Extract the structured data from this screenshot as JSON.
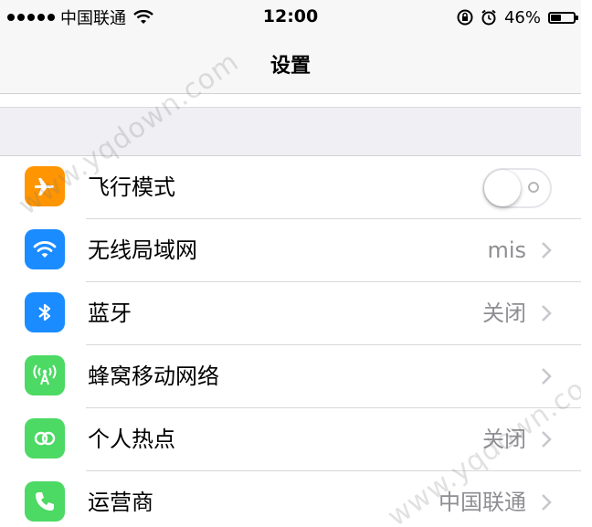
{
  "status_bar": {
    "carrier": "中国联通",
    "time": "12:00",
    "battery": "46%",
    "battery_level": 0.46,
    "icons": [
      "signal-dots-icon",
      "wifi-icon",
      "rotation-lock-icon",
      "alarm-icon",
      "battery-icon"
    ]
  },
  "nav": {
    "title": "设置"
  },
  "settings": [
    {
      "label": "飞行模式",
      "icon": "airplane-icon",
      "color": "#ff9500",
      "toggle": "off"
    },
    {
      "label": "无线局域网",
      "icon": "wifi-icon",
      "color": "#1a8cff",
      "value": "mis"
    },
    {
      "label": "蓝牙",
      "icon": "bluetooth-icon",
      "color": "#1a8cff",
      "value": "关闭"
    },
    {
      "label": "蜂窝移动网络",
      "icon": "cellular-icon",
      "color": "#4cd964",
      "value": ""
    },
    {
      "label": "个人热点",
      "icon": "hotspot-icon",
      "color": "#4cd964",
      "value": "关闭"
    },
    {
      "label": "运营商",
      "icon": "phone-icon",
      "color": "#4cd964",
      "value": "中国联通"
    }
  ],
  "watermark": "www.yqdown.com",
  "colors": {
    "orange": "#ff9500",
    "blue": "#1a8cff",
    "green": "#4cd964",
    "secondary_text": "#8e8e93",
    "group_bg": "#efeff4"
  }
}
